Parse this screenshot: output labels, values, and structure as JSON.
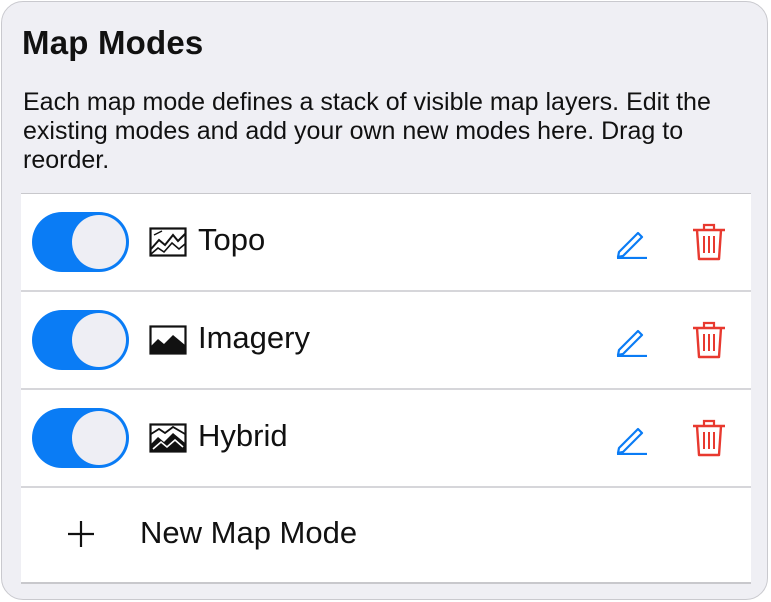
{
  "panel": {
    "title": "Map Modes",
    "description": "Each map mode defines a stack of visible map layers. Edit the existing modes and add your own new modes here. Drag to reorder."
  },
  "modes": [
    {
      "label": "Topo",
      "enabled": true,
      "icon": "topo-map-icon"
    },
    {
      "label": "Imagery",
      "enabled": true,
      "icon": "imagery-map-icon"
    },
    {
      "label": "Hybrid",
      "enabled": true,
      "icon": "hybrid-map-icon"
    }
  ],
  "add_row": {
    "label": "New Map Mode",
    "icon": "plus-icon"
  },
  "colors": {
    "accent": "#0a7cf5",
    "delete": "#e8392f",
    "background": "#efeff4"
  }
}
